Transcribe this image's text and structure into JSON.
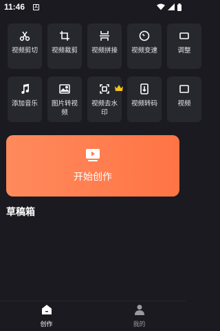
{
  "status_bar": {
    "time": "11:46",
    "notif_letter": "A"
  },
  "tools_row1": [
    {
      "label": "视频剪切",
      "icon": "scissors-icon"
    },
    {
      "label": "视频裁剪",
      "icon": "crop-icon"
    },
    {
      "label": "视频拼接",
      "icon": "merge-icon"
    },
    {
      "label": "视频变速",
      "icon": "speed-icon"
    },
    {
      "label": "调整",
      "icon": "adjust-icon"
    }
  ],
  "tools_row2": [
    {
      "label": "添加音乐",
      "icon": "music-note-icon"
    },
    {
      "label": "图片转视频",
      "icon": "image-icon"
    },
    {
      "label": "视频去水印",
      "icon": "remove-watermark-icon",
      "badge": "crown-icon"
    },
    {
      "label": "视频转码",
      "icon": "transcode-icon"
    },
    {
      "label": "视频",
      "icon": "video-icon"
    }
  ],
  "start_card": {
    "label": "开始创作",
    "icon": "play-video-icon"
  },
  "drafts": {
    "title": "草稿箱"
  },
  "bottom_nav": {
    "create": {
      "label": "创作",
      "icon": "home-icon"
    },
    "mine": {
      "label": "我的",
      "icon": "person-icon"
    }
  },
  "colors": {
    "background": "#1a1a20",
    "tile": "#27272e",
    "accent_start": "#ff8a5c",
    "accent_end": "#ff7445",
    "crown": "#f5c518"
  }
}
